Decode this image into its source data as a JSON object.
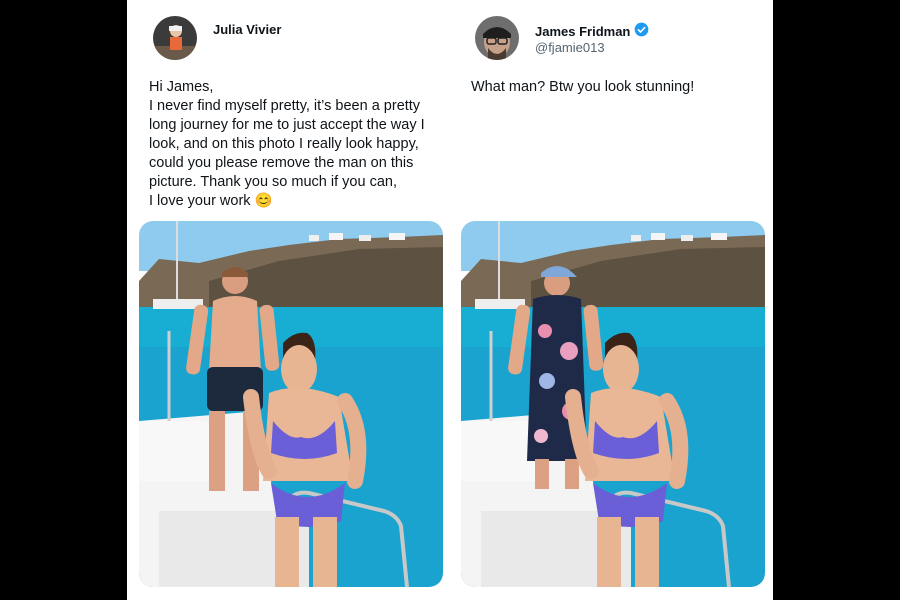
{
  "left_tweet": {
    "author_name": "Julia Vivier",
    "lines": [
      "Hi James,",
      "I never find myself pretty, it’s been a pretty",
      "long journey for me to just accept the way I",
      "look, and on this photo I really look happy,",
      "could you please remove the man on this",
      "picture. Thank you so much if you can,",
      "I love your work 😊"
    ]
  },
  "right_tweet": {
    "author_name": "James Fridman",
    "handle": "@fjamie013",
    "text": "What man? Btw you look stunning!",
    "verified_icon": "verified-badge-icon"
  },
  "colors": {
    "sky": "#9fd4f2",
    "sea": "#1aa3cf",
    "verified": "#1d9bf0",
    "bikini": "#6a5fd6"
  }
}
